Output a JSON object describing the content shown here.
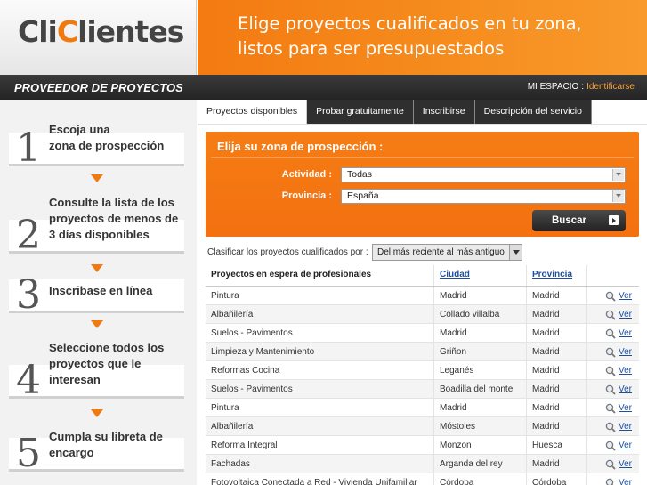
{
  "header": {
    "logo": {
      "part1": "Cli",
      "accent": "C",
      "part2": "lientes"
    },
    "banner_line1": "Elige proyectos cualificados en tu zona,",
    "banner_line2": "listos para ser presupuestados"
  },
  "topbar": {
    "title": "PROVEEDOR DE PROYECTOS",
    "space_label": "MI ESPACIO",
    "separator": ":",
    "login_link": "Identificarse"
  },
  "sidebar": {
    "steps": [
      {
        "number": "1",
        "lines": [
          "Escoja una",
          "zona de prospección"
        ]
      },
      {
        "number": "2",
        "lines": [
          "Consulte la lista de los",
          "proyectos de menos de",
          "3 días disponibles"
        ]
      },
      {
        "number": "3",
        "lines": [
          "Inscribase en línea"
        ]
      },
      {
        "number": "4",
        "lines": [
          "Seleccione todos los",
          "proyectos que le",
          "interesan"
        ]
      },
      {
        "number": "5",
        "lines": [
          "Cumpla su libreta de",
          "encargo"
        ]
      }
    ]
  },
  "tabs": [
    {
      "label": "Proyectos disponibles",
      "active": true
    },
    {
      "label": "Probar gratuitamente",
      "active": false
    },
    {
      "label": "Inscribirse",
      "active": false
    },
    {
      "label": "Descripción del servicio",
      "active": false
    }
  ],
  "zone": {
    "title": "Elija su zona de prospección :",
    "activity_label": "Actividad :",
    "activity_value": "Todas",
    "province_label": "Provincia :",
    "province_value": "España",
    "search_button": "Buscar"
  },
  "sort": {
    "label": "Clasificar los proyectos cualificados por :",
    "selected": "Del más reciente al más antiguo"
  },
  "table": {
    "headers": {
      "project": "Proyectos en espera de profesionales",
      "city": "Ciudad",
      "province": "Provincia"
    },
    "view_label": "Ver",
    "rows": [
      {
        "project": "Pintura",
        "city": "Madrid",
        "province": "Madrid"
      },
      {
        "project": "Albañilería",
        "city": "Collado villalba",
        "province": "Madrid"
      },
      {
        "project": "Suelos - Pavimentos",
        "city": "Madrid",
        "province": "Madrid"
      },
      {
        "project": "Limpieza y Mantenimiento",
        "city": "Griñon",
        "province": "Madrid"
      },
      {
        "project": "Reformas Cocina",
        "city": "Leganés",
        "province": "Madrid"
      },
      {
        "project": "Suelos - Pavimentos",
        "city": "Boadilla del monte",
        "province": "Madrid"
      },
      {
        "project": "Pintura",
        "city": "Madrid",
        "province": "Madrid"
      },
      {
        "project": "Albañilería",
        "city": "Móstoles",
        "province": "Madrid"
      },
      {
        "project": "Reforma Integral",
        "city": "Monzon",
        "province": "Huesca"
      },
      {
        "project": "Fachadas",
        "city": "Arganda del rey",
        "province": "Madrid"
      },
      {
        "project": "Fotovoltaica Conectada a Red - Vivienda Unifamiliar",
        "city": "Córdoba",
        "province": "Córdoba"
      }
    ]
  },
  "colors": {
    "accent": "#f47a12",
    "dark": "#2a2a2a",
    "link": "#1d4fa0"
  }
}
